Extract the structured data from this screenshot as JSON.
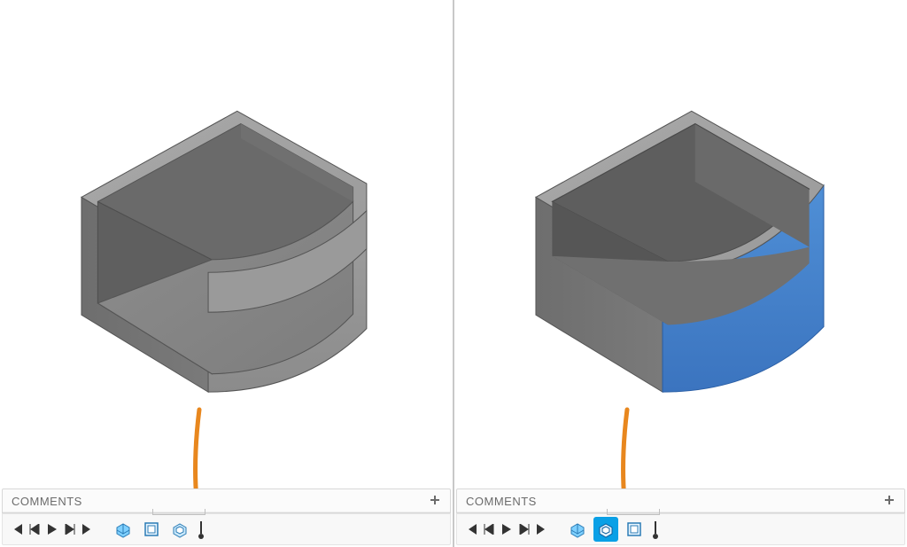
{
  "panes": [
    {
      "comments_label": "COMMENTS",
      "timeline": {
        "features": [
          {
            "name": "extrude-feature",
            "selected": false
          },
          {
            "name": "shell-feature",
            "selected": false
          },
          {
            "name": "extrude-cut-feature",
            "selected": false
          }
        ],
        "bracket_feature_indices": [
          1,
          2
        ]
      }
    },
    {
      "comments_label": "COMMENTS",
      "timeline": {
        "features": [
          {
            "name": "extrude-feature",
            "selected": false
          },
          {
            "name": "extrude-cut-feature",
            "selected": true
          },
          {
            "name": "shell-feature",
            "selected": false
          }
        ],
        "bracket_feature_indices": [
          1,
          2
        ]
      }
    }
  ]
}
